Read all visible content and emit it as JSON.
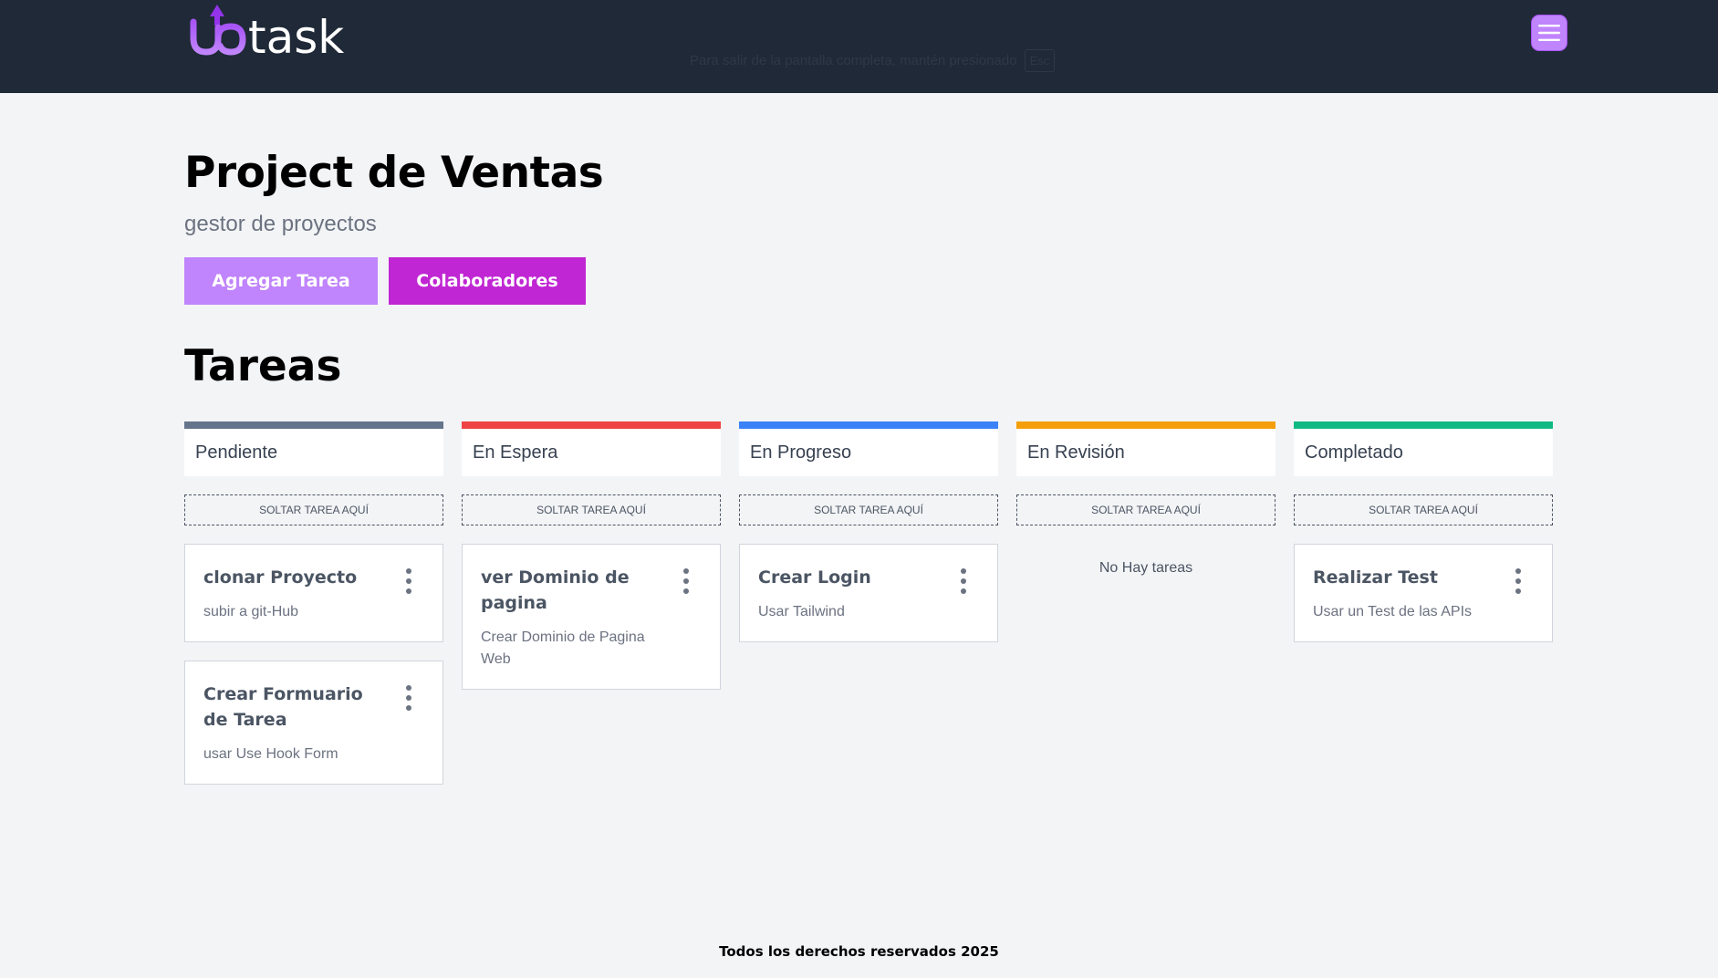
{
  "header": {
    "logo_text": "uptask",
    "fullscreen_hint": "Para salir de la pantalla completa, mantén presionado",
    "fullscreen_key": "Esc",
    "menu_icon": "hamburger-icon",
    "colors": {
      "bg": "#1f2937",
      "accent": "#c084fc"
    }
  },
  "project": {
    "title": "Project de Ventas",
    "subtitle": "gestor de proyectos",
    "add_task_label": "Agregar Tarea",
    "collaborators_label": "Colaboradores"
  },
  "tasks_section": {
    "title": "Tareas",
    "drop_label": "Soltar tarea aquí",
    "empty_label": "No Hay tareas",
    "columns": [
      {
        "label": "Pendiente",
        "color": "#64748b",
        "tasks": [
          {
            "name": "clonar Proyecto",
            "description": "subir a git-Hub"
          },
          {
            "name": "Crear Formuario de Tarea",
            "description": "usar Use Hook Form"
          }
        ]
      },
      {
        "label": "En Espera",
        "color": "#ef4444",
        "tasks": [
          {
            "name": "ver Dominio de pagina",
            "description": "Crear Dominio de Pagina Web"
          }
        ]
      },
      {
        "label": "En Progreso",
        "color": "#3b82f6",
        "tasks": [
          {
            "name": "Crear Login",
            "description": "Usar Tailwind"
          }
        ]
      },
      {
        "label": "En Revisión",
        "color": "#f59e0b",
        "tasks": []
      },
      {
        "label": "Completado",
        "color": "#10b981",
        "tasks": [
          {
            "name": "Realizar Test",
            "description": "Usar un Test de las APIs"
          }
        ]
      }
    ]
  },
  "footer": {
    "text": "Todos los derechos reservados 2025"
  }
}
